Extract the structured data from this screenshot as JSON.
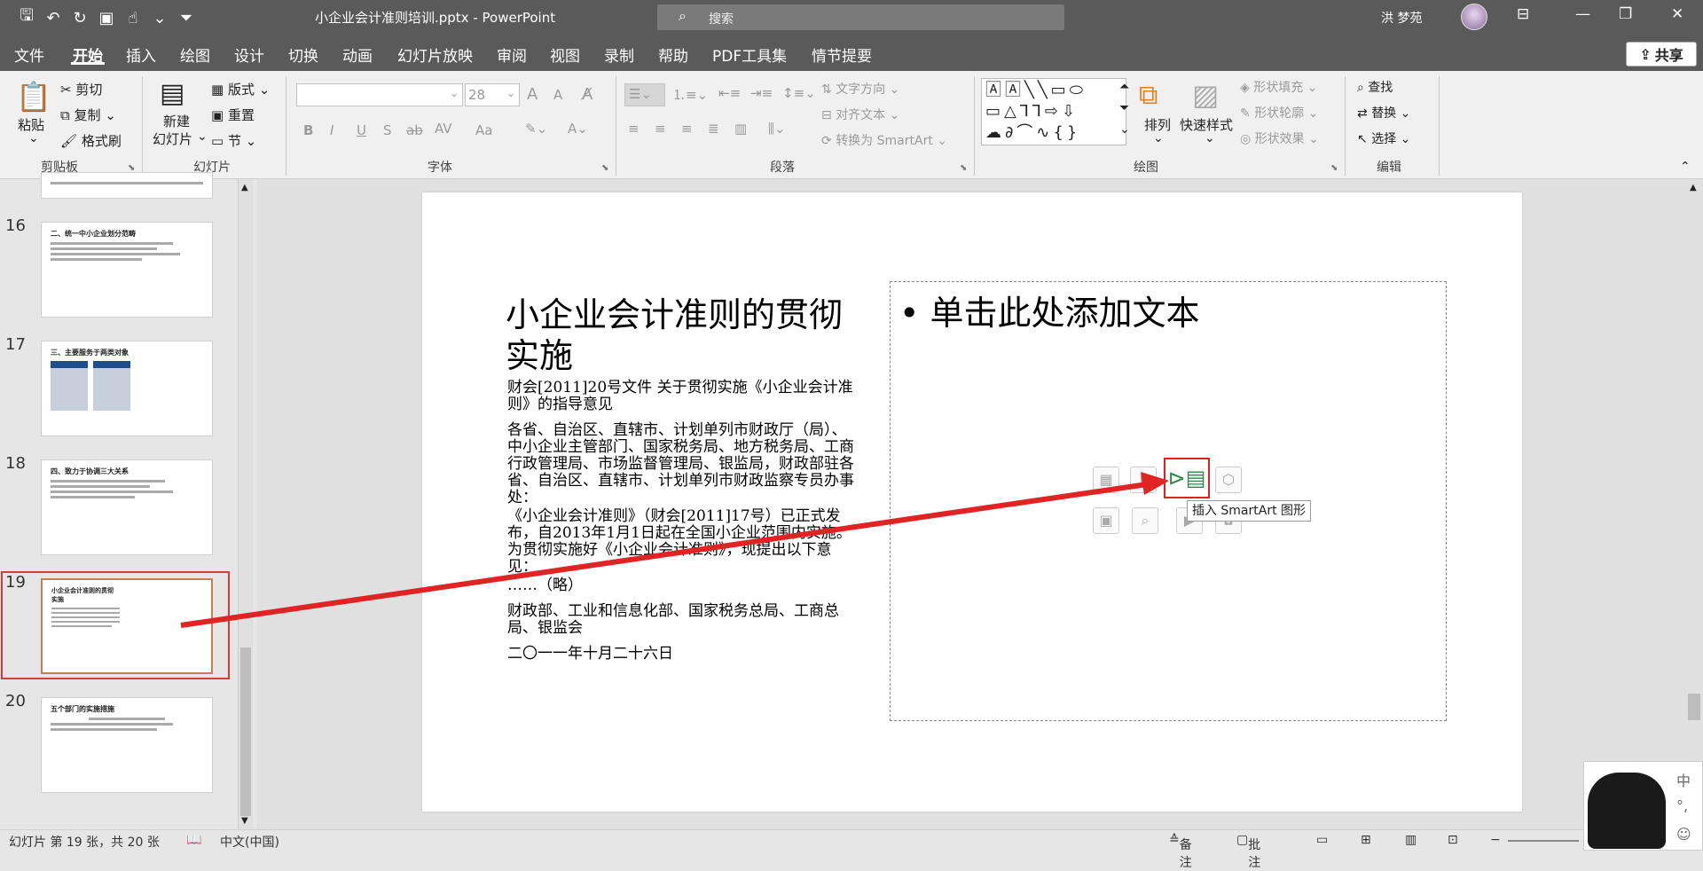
{
  "window": {
    "title": "小企业会计准则培训.pptx  -  PowerPoint",
    "search_placeholder": "搜索",
    "user": "洪 梦苑",
    "share": "共享"
  },
  "qat": {
    "save": "🖫",
    "undo": "↶",
    "redo": "↻",
    "present": "▣",
    "touch": "☝",
    "more": "⌄",
    "customize": "⏷"
  },
  "tabs": [
    "文件",
    "开始",
    "插入",
    "绘图",
    "设计",
    "切换",
    "动画",
    "幻灯片放映",
    "审阅",
    "视图",
    "录制",
    "帮助",
    "PDF工具集",
    "情节提要"
  ],
  "active_tab": "开始",
  "ribbon": {
    "clipboard": {
      "paste": "粘贴",
      "cut": "剪切",
      "copy": "复制",
      "format_painter": "格式刷",
      "group": "剪贴板"
    },
    "slides": {
      "new_slide_1": "新建",
      "new_slide_2": "幻灯片",
      "layout": "版式",
      "reset": "重置",
      "section": "节",
      "group": "幻灯片"
    },
    "font": {
      "size": "28",
      "group": "字体",
      "bold": "B",
      "italic": "I",
      "underline": "U",
      "strike": "S",
      "shadow": "ab",
      "spacing": "AV",
      "case": "Aa",
      "grow": "A",
      "shrink": "A"
    },
    "paragraph": {
      "text_direction": "文字方向",
      "align_text": "对齐文本",
      "convert_smartart": "转换为 SmartArt",
      "group": "段落"
    },
    "drawing": {
      "arrange": "排列",
      "quick_styles": "快速样式",
      "shape_fill": "形状填充",
      "shape_outline": "形状轮廓",
      "shape_effects": "形状效果",
      "group": "绘图"
    },
    "editing": {
      "find": "查找",
      "replace": "替换",
      "select": "选择",
      "group": "编辑"
    }
  },
  "thumbnails": [
    {
      "num": "16",
      "title": "二、统一中小企业划分范畴"
    },
    {
      "num": "17",
      "title": "三、主要服务于两类对象"
    },
    {
      "num": "18",
      "title": "四、致力于协调三大关系"
    },
    {
      "num": "19",
      "title": "小企业会计准则的贯彻实施"
    },
    {
      "num": "20",
      "title": "五个部门的实施措施"
    }
  ],
  "slide": {
    "title": "小企业会计准则的贯彻实施",
    "p1": "财会[2011]20号文件              关于贯彻实施《小企业会计准则》的指导意见",
    "p2": "        各省、自治区、直辖市、计划单列市财政厅（局）、中小企业主管部门、国家税务局、地方税务局、工商行政管理局、市场监督管理局、银监局，财政部驻各省、自治区、直辖市、计划单列市财政监察专员办事处：",
    "p3": "        《小企业会计准则》（财会[2011]17号）已正式发布，自2013年1月1日起在全国小企业范围内实施。为贯彻实施好《小企业会计准则》，现提出以下意见：",
    "p4": "       ……（略）",
    "p5": "财政部、工业和信息化部、国家税务总局、工商总局、银监会",
    "p6": "二〇一一年十月二十六日",
    "placeholder": "• 单击此处添加文本",
    "tooltip": "插入 SmartArt 图形"
  },
  "status": {
    "slide_info": "幻灯片 第 19 张，共 20 张",
    "language": "中文(中国)",
    "notes": "备注",
    "comments": "批注"
  },
  "ime": {
    "lang": "中",
    "punct": "°,",
    "skin": "☺"
  },
  "colors": {
    "titlebar": "#5a5a5a",
    "arrow": "#e02424",
    "selection": "#d93a3a"
  }
}
